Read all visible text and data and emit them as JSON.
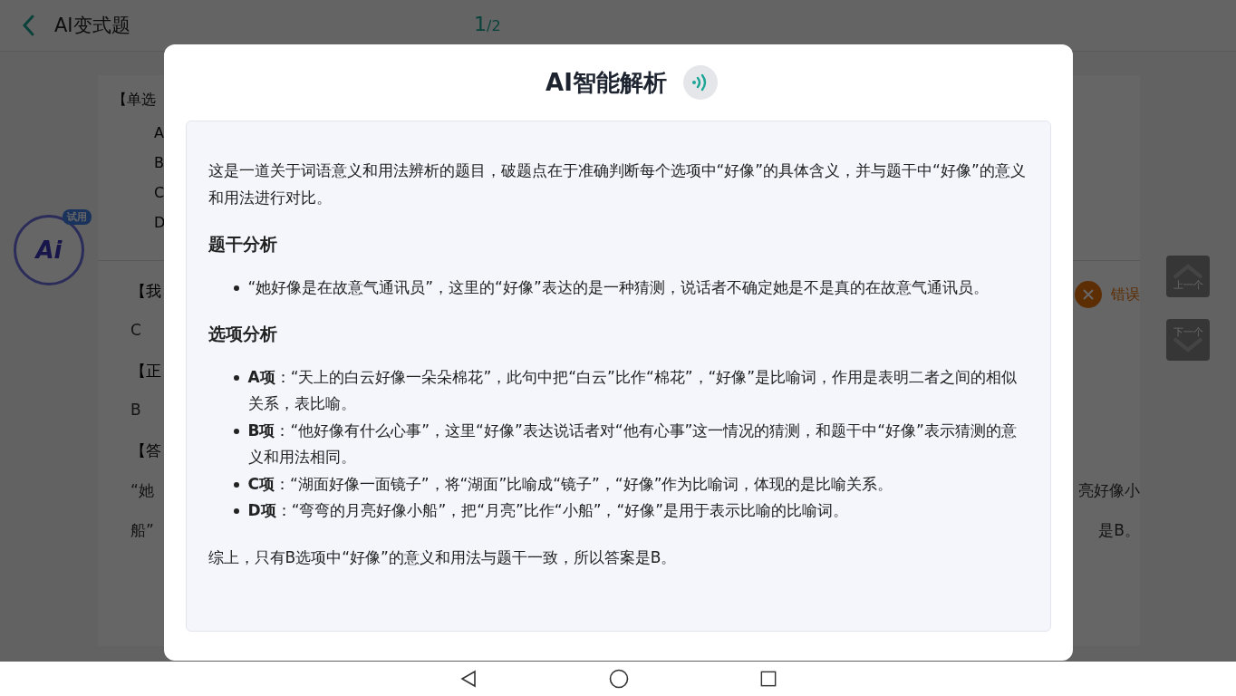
{
  "header": {
    "title": "AI变式题",
    "counter_current": "1",
    "counter_total": "/2"
  },
  "ai_badge": {
    "tag": "试用",
    "text": "Ai"
  },
  "question_card": {
    "top_lines": [
      "【单选",
      "A",
      "B",
      "C",
      "D"
    ],
    "answer_lines": [
      {
        "kind": "label",
        "left": "【我"
      },
      {
        "kind": "value",
        "left": "C"
      },
      {
        "kind": "label",
        "left": "【正"
      },
      {
        "kind": "value",
        "left": "B"
      },
      {
        "kind": "label",
        "left": "【答"
      },
      {
        "kind": "value",
        "left": "“她",
        "right": "亮好像小"
      },
      {
        "kind": "value",
        "left": "船”",
        "right": "是B。"
      }
    ],
    "status": {
      "label": "错误",
      "correct": false
    }
  },
  "nav_buttons": [
    {
      "kind": "up",
      "label": "上一个"
    },
    {
      "kind": "down",
      "label": "下一个"
    }
  ],
  "modal": {
    "title": "AI智能解析",
    "blocks": [
      {
        "kind": "paragraph",
        "text": "这是一道关于词语意义和用法辨析的题目，破题点在于准确判断每个选项中“好像”的具体含义，并与题干中“好像”的意义和用法进行对比。"
      },
      {
        "kind": "heading",
        "text": "题干分析"
      },
      {
        "kind": "bullets",
        "items": [
          "“她好像是在故意气通讯员”，这里的“好像”表达的是一种猜测，说话者不确定她是不是真的在故意气通讯员。"
        ]
      },
      {
        "kind": "heading",
        "text": "选项分析"
      },
      {
        "kind": "bullets",
        "items": [
          "**A项**：“天上的白云好像一朵朵棉花”，此句中把“白云”比作“棉花”，“好像”是比喻词，作用是表明二者之间的相似关系，表比喻。",
          "**B项**：“他好像有什么心事”，这里“好像”表达说话者对“他有心事”这一情况的猜测，和题干中“好像”表示猜测的意义和用法相同。",
          "**C项**：“湖面好像一面镜子”，将“湖面”比喻成“镜子”，“好像”作为比喻词，体现的是比喻关系。",
          "**D项**：“弯弯的月亮好像小船”，把“月亮”比作“小船”，“好像”是用于表示比喻的比喻词。"
        ]
      },
      {
        "kind": "paragraph",
        "text": "综上，只有B选项中“好像”的意义和用法与题干一致，所以答案是B。"
      }
    ]
  }
}
